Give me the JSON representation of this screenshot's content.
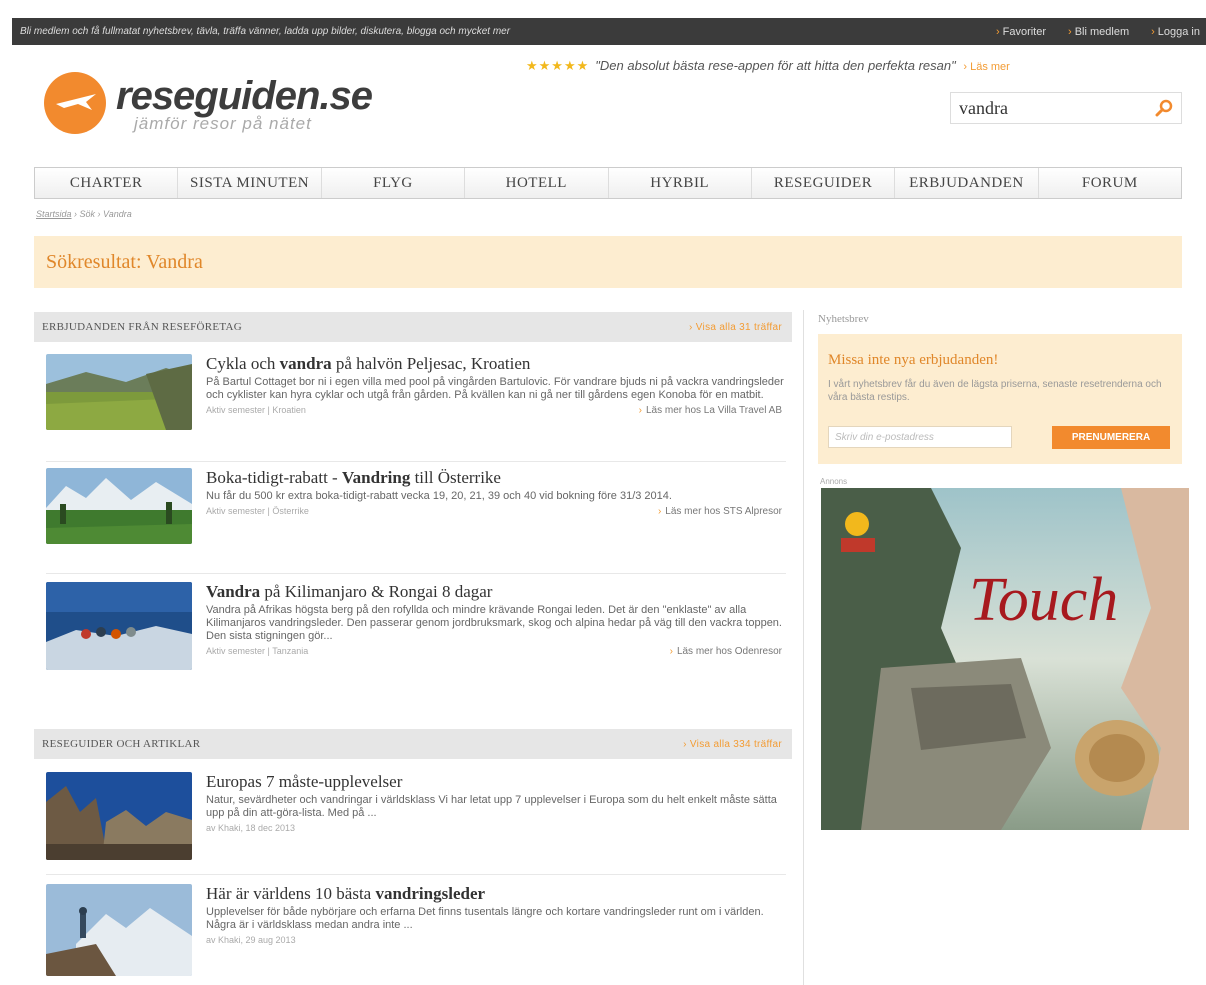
{
  "topbar": {
    "tagline": "Bli medlem och få fullmatat nyhetsbrev, tävla, träffa vänner, ladda upp bilder, diskutera, blogga och mycket mer",
    "favorites": "Favoriter",
    "become_member": "Bli medlem",
    "login": "Logga in"
  },
  "brand": {
    "name": "reseguiden.se",
    "tagline": "jämför resor på nätet",
    "accent": "#f28a2e"
  },
  "quote": {
    "stars": "★★★★★",
    "text": "\"Den absolut bästa rese-appen för att hitta den perfekta resan\"",
    "more": "Läs mer"
  },
  "search": {
    "value": "vandra",
    "icon": "search-icon"
  },
  "nav": [
    "CHARTER",
    "SISTA MINUTEN",
    "FLYG",
    "HOTELL",
    "HYRBIL",
    "RESEGUIDER",
    "ERBJUDANDEN",
    "FORUM"
  ],
  "breadcrumb": {
    "home": "Startsida",
    "search": "Sök",
    "current": "Vandra"
  },
  "results_title": "Sökresultat: Vandra",
  "offers": {
    "heading": "ERBJUDANDEN FRÅN RESEFÖRETAG",
    "view_all": "Visa alla 31 träffar",
    "items": [
      {
        "title_pre": "Cykla och ",
        "title_hl": "vandra",
        "title_post": " på halvön Peljesac, Kroatien",
        "desc": "På Bartul Cottaget bor ni i egen villa med pool på vingården Bartulovic. För vandrare bjuds ni på vackra vandringsleder och cyklister kan hyra cyklar och utgå från gården. På kvällen kan ni gå ner till gårdens egen Konoba för en matbit.",
        "meta": "Aktiv semester  |  Kroatien",
        "link": "Läs mer hos La Villa Travel AB"
      },
      {
        "title_pre": "Boka-tidigt-rabatt - ",
        "title_hl": "Vandring",
        "title_post": " till Österrike",
        "desc": "Nu får du 500 kr extra boka-tidigt-rabatt vecka 19, 20, 21, 39 och 40 vid bokning före 31/3 2014.",
        "meta": "Aktiv semester  |  Österrike",
        "link": "Läs mer hos STS Alpresor"
      },
      {
        "title_pre": "",
        "title_hl": "Vandra",
        "title_post": " på Kilimanjaro & Rongai 8 dagar",
        "desc": "Vandra på Afrikas högsta berg på den rofyllda och mindre krävande Rongai leden. Det är den \"enklaste\" av alla Kilimanjaros vandringsleder. Den passerar genom jordbruksmark, skog och alpina hedar på väg till den vackra toppen. Den sista stigningen gör...",
        "meta": "Aktiv semester  |  Tanzania",
        "link": "Läs mer hos Odenresor"
      }
    ]
  },
  "guides": {
    "heading": "RESEGUIDER OCH ARTIKLAR",
    "view_all": "Visa alla 334 träffar",
    "items": [
      {
        "title_pre": "Europas 7 måste-upplevelser",
        "title_hl": "",
        "title_post": "",
        "desc": "Natur, sevärdheter och vandringar i världsklass Vi har letat upp 7 upplevelser i Europa som du helt enkelt måste sätta upp på din att-göra-lista. Med på ...",
        "meta": "av Khaki, 18 dec 2013"
      },
      {
        "title_pre": "Här är världens 10 bästa ",
        "title_hl": "vandringsleder",
        "title_post": "",
        "desc": "Upplevelser för både nybörjare och erfarna Det finns tusentals längre och kortare vandringsleder runt om i världen. Några är i världsklass medan andra inte ...",
        "meta": "av Khaki, 29 aug 2013"
      }
    ]
  },
  "newsletter": {
    "label": "Nyhetsbrev",
    "title": "Missa inte nya erbjudanden!",
    "desc": "I vårt nyhetsbrev får du även de lägsta priserna, senaste resetrenderna och våra bästa restips.",
    "placeholder": "Skriv din e-postadress",
    "button": "PRENUMERERA"
  },
  "ad": {
    "label": "Annons",
    "text": "Touch"
  }
}
